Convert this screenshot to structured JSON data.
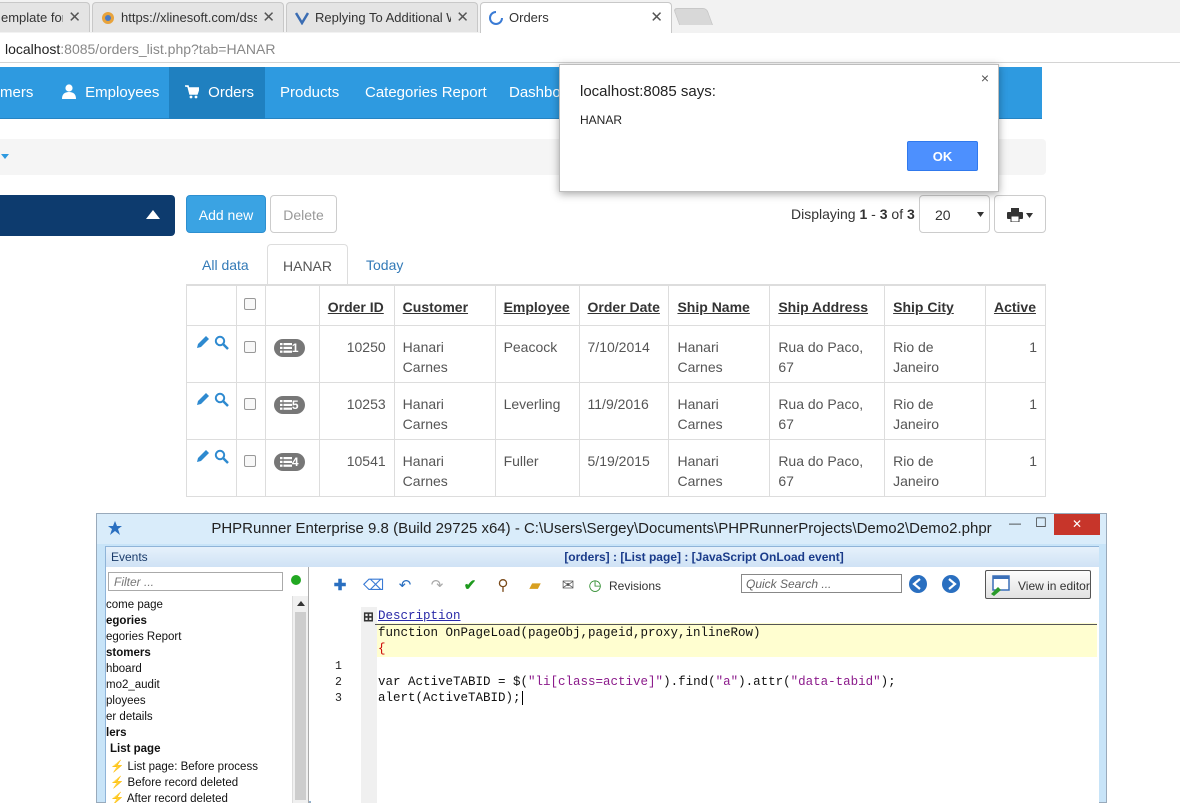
{
  "browser": {
    "tabs": [
      {
        "title": "emplate for"
      },
      {
        "title": "https://xlinesoft.com/dss"
      },
      {
        "title": "Replying To Additional W"
      },
      {
        "title": "Orders"
      }
    ],
    "close_glyph": "✕",
    "address_host": "localhost",
    "address_rest": ":8085/orders_list.php?tab=HANAR"
  },
  "navbar": {
    "items": [
      {
        "label": "mers"
      },
      {
        "label": "Employees"
      },
      {
        "label": "Orders"
      },
      {
        "label": "Products"
      },
      {
        "label": "Categories Report"
      },
      {
        "label": "Dashbo"
      }
    ]
  },
  "toolbar": {
    "add_label": "Add new",
    "delete_label": "Delete",
    "displaying_prefix": "Displaying ",
    "displaying_from": "1",
    "displaying_dash": " - ",
    "displaying_to": "3",
    "displaying_of": " of ",
    "displaying_total": "3",
    "page_size": "20"
  },
  "subtabs": [
    {
      "label": "All data"
    },
    {
      "label": "HANAR"
    },
    {
      "label": "Today"
    }
  ],
  "grid": {
    "headers": [
      "Order ID",
      "Customer",
      "Employee",
      "Order Date",
      "Ship Name",
      "Ship Address",
      "Ship City",
      "Active"
    ],
    "rows": [
      {
        "badge": "1",
        "order_id": "10250",
        "customer": "Hanari Carnes",
        "employee": "Peacock",
        "order_date": "7/10/2014",
        "ship_name": "Hanari Carnes",
        "ship_address": "Rua do Paco, 67",
        "ship_city": "Rio de Janeiro",
        "active": "1"
      },
      {
        "badge": "5",
        "order_id": "10253",
        "customer": "Hanari Carnes",
        "employee": "Leverling",
        "order_date": "11/9/2016",
        "ship_name": "Hanari Carnes",
        "ship_address": "Rua do Paco, 67",
        "ship_city": "Rio de Janeiro",
        "active": "1"
      },
      {
        "badge": "4",
        "order_id": "10541",
        "customer": "Hanari Carnes",
        "employee": "Fuller",
        "order_date": "5/19/2015",
        "ship_name": "Hanari Carnes",
        "ship_address": "Rua do Paco, 67",
        "ship_city": "Rio de Janeiro",
        "active": "1"
      }
    ]
  },
  "alert": {
    "title": "localhost:8085 says:",
    "message": "HANAR",
    "ok_label": "OK",
    "close_glyph": "×"
  },
  "ide": {
    "title": "PHPRunner Enterprise 9.8 (Build 29725 x64) - C:\\Users\\Sergey\\Documents\\PHPRunnerProjects\\Demo2\\Demo2.phpr",
    "events_label": "Events",
    "tab_header": "[orders] : [List page] : [JavaScript OnLoad event]",
    "filter_placeholder": "Filter ...",
    "revisions_label": "Revisions",
    "quick_search_placeholder": "Quick Search ...",
    "view_in_editor_label": "View in editor",
    "tree": [
      {
        "label": "come page",
        "bold": false
      },
      {
        "label": "egories",
        "bold": true
      },
      {
        "label": "egories Report",
        "bold": false
      },
      {
        "label": "stomers",
        "bold": true
      },
      {
        "label": "hboard",
        "bold": false
      },
      {
        "label": "mo2_audit",
        "bold": false
      },
      {
        "label": "ployees",
        "bold": false
      },
      {
        "label": "er details",
        "bold": false
      },
      {
        "label": "lers",
        "bold": true
      },
      {
        "label": "List page",
        "bold": true
      },
      {
        "label": "List page: Before process",
        "bold": false
      },
      {
        "label": "Before record deleted",
        "bold": false
      },
      {
        "label": "After record deleted",
        "bold": false
      }
    ],
    "code": {
      "description": "Description",
      "line_fn": "function OnPageLoad(pageObj,pageid,proxy,inlineRow)",
      "line_brace": "{",
      "line_numbers": [
        "1",
        "2",
        "3"
      ],
      "line2_a": "var ActiveTABID = $(",
      "line2_s1": "\"li[class=active]\"",
      "line2_b": ").find(",
      "line2_s2": "\"a\"",
      "line2_c": ").attr(",
      "line2_s3": "\"data-tabid\"",
      "line2_d": ");",
      "line3": "alert(ActiveTABID);"
    },
    "window_controls": {
      "minimize": "—",
      "maximize": "☐",
      "close": "✕"
    }
  },
  "colors": {
    "navbar": "#2e9ae0",
    "navbar_active": "#1f80c0",
    "primary_button": "#3aa3e3",
    "dark_panel": "#0d3b6e",
    "alert_ok": "#4d90fe",
    "ide_close": "#c7352a"
  }
}
